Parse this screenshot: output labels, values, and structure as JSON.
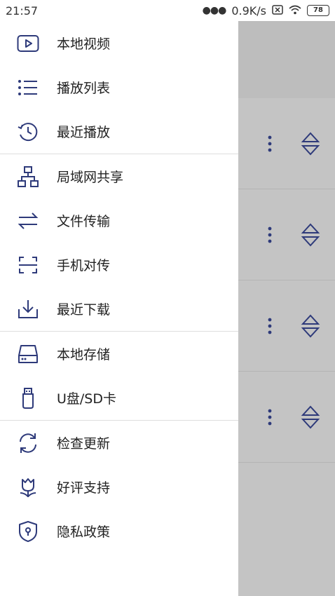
{
  "status_bar": {
    "time": "21:57",
    "network_speed": "0.9K/s",
    "battery": "78"
  },
  "drawer": {
    "groups": [
      [
        {
          "label": "本地视频",
          "icon": "video-icon"
        },
        {
          "label": "播放列表",
          "icon": "list-icon"
        },
        {
          "label": "最近播放",
          "icon": "history-icon"
        }
      ],
      [
        {
          "label": "局域网共享",
          "icon": "network-icon"
        },
        {
          "label": "文件传输",
          "icon": "transfer-icon"
        },
        {
          "label": "手机对传",
          "icon": "scan-icon"
        },
        {
          "label": "最近下载",
          "icon": "download-icon"
        }
      ],
      [
        {
          "label": "本地存储",
          "icon": "storage-icon"
        },
        {
          "label": "U盘/SD卡",
          "icon": "usb-icon"
        }
      ],
      [
        {
          "label": "检查更新",
          "icon": "refresh-icon"
        },
        {
          "label": "好评支持",
          "icon": "flower-icon"
        },
        {
          "label": "隐私政策",
          "icon": "shield-icon"
        }
      ]
    ]
  },
  "colors": {
    "icon": "#2e3a7a",
    "overlay": "#c4c4c4"
  }
}
